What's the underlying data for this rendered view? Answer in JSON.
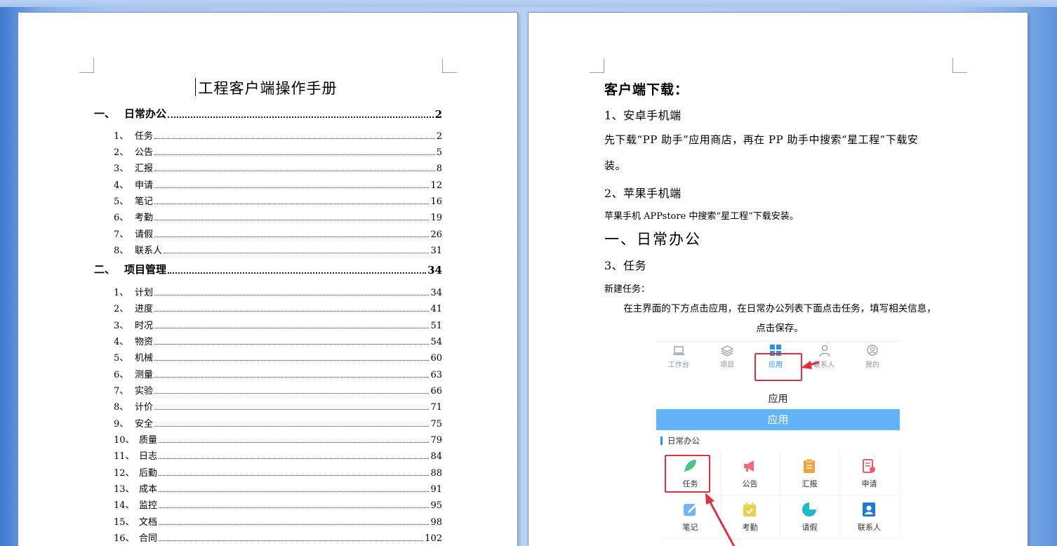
{
  "toc": {
    "title": "工程客户端操作手册",
    "sections": [
      {
        "num": "一、",
        "label": "日常办公",
        "page": "2",
        "items": [
          {
            "num": "1、",
            "label": "任务",
            "page": "2"
          },
          {
            "num": "2、",
            "label": "公告",
            "page": "5"
          },
          {
            "num": "3、",
            "label": "汇报",
            "page": "8"
          },
          {
            "num": "4、",
            "label": "申请",
            "page": "12"
          },
          {
            "num": "5、",
            "label": "笔记",
            "page": "16"
          },
          {
            "num": "6、",
            "label": "考勤",
            "page": "19"
          },
          {
            "num": "7、",
            "label": "请假",
            "page": "26"
          },
          {
            "num": "8、",
            "label": "联系人",
            "page": "31"
          }
        ]
      },
      {
        "num": "二、",
        "label": "项目管理",
        "page": "34",
        "items": [
          {
            "num": "1、",
            "label": "计划",
            "page": "34"
          },
          {
            "num": "2、",
            "label": "进度",
            "page": "41"
          },
          {
            "num": "3、",
            "label": "时况",
            "page": "51"
          },
          {
            "num": "4、",
            "label": "物资",
            "page": "54"
          },
          {
            "num": "5、",
            "label": "机械",
            "page": "60"
          },
          {
            "num": "6、",
            "label": "测量",
            "page": "63"
          },
          {
            "num": "7、",
            "label": "实验",
            "page": "66"
          },
          {
            "num": "8、",
            "label": "计价",
            "page": "71"
          },
          {
            "num": "9、",
            "label": "安全",
            "page": "75"
          },
          {
            "num": "10、",
            "label": "质量",
            "page": "79"
          },
          {
            "num": "11、",
            "label": "日志",
            "page": "84"
          },
          {
            "num": "12、",
            "label": "后勤",
            "page": "88"
          },
          {
            "num": "13、",
            "label": "成本",
            "page": "91"
          },
          {
            "num": "14、",
            "label": "监控",
            "page": "95"
          },
          {
            "num": "15、",
            "label": "文档",
            "page": "98"
          },
          {
            "num": "16、",
            "label": "合同",
            "page": "102"
          }
        ]
      }
    ]
  },
  "right": {
    "download_heading": "客户端下载：",
    "android_heading": "1、安卓手机端",
    "android_body_line1": "先下载“PP 助手”应用商店，再在 PP 助手中搜索“星工程”下载安",
    "android_body_line2": "装。",
    "ios_heading": "2、苹果手机端",
    "ios_body": "苹果手机 APPstore 中搜索“星工程”下载安装。",
    "section_heading": "一、日常办公",
    "task_heading": "3、任务",
    "new_task_label": "新建任务：",
    "instruction_line1": "在主界面的下方点击应用，在日常办公列表下面点击任务，填写相关信息，",
    "instruction_line2": "点击保存。"
  },
  "app_screenshot": {
    "tabs": [
      {
        "label": "工作台",
        "icon": "laptop-icon"
      },
      {
        "label": "项目",
        "icon": "layers-icon"
      },
      {
        "label": "应用",
        "icon": "apps-grid-icon",
        "active": true
      },
      {
        "label": "联系人",
        "icon": "contacts-icon"
      },
      {
        "label": "我的",
        "icon": "profile-icon"
      }
    ],
    "caption": "应用",
    "header": "应用",
    "section_title": "日常办公",
    "apps": [
      {
        "label": "任务",
        "icon": "rocket-icon",
        "color": "#4cc38a"
      },
      {
        "label": "公告",
        "icon": "megaphone-icon",
        "color": "#f06a7a"
      },
      {
        "label": "汇报",
        "icon": "clipboard-icon",
        "color": "#f5a13a"
      },
      {
        "label": "申请",
        "icon": "document-icon",
        "color": "#ef5a6a"
      },
      {
        "label": "笔记",
        "icon": "note-icon",
        "color": "#6fb6f5"
      },
      {
        "label": "考勤",
        "icon": "calendar-check-icon",
        "color": "#e6d24a"
      },
      {
        "label": "请假",
        "icon": "pie-icon",
        "color": "#1fb8c8"
      },
      {
        "label": "联系人",
        "icon": "contact-card-icon",
        "color": "#1d7ad8"
      }
    ],
    "highlight_color": "#e2303f",
    "accent_color": "#62b4f9"
  }
}
